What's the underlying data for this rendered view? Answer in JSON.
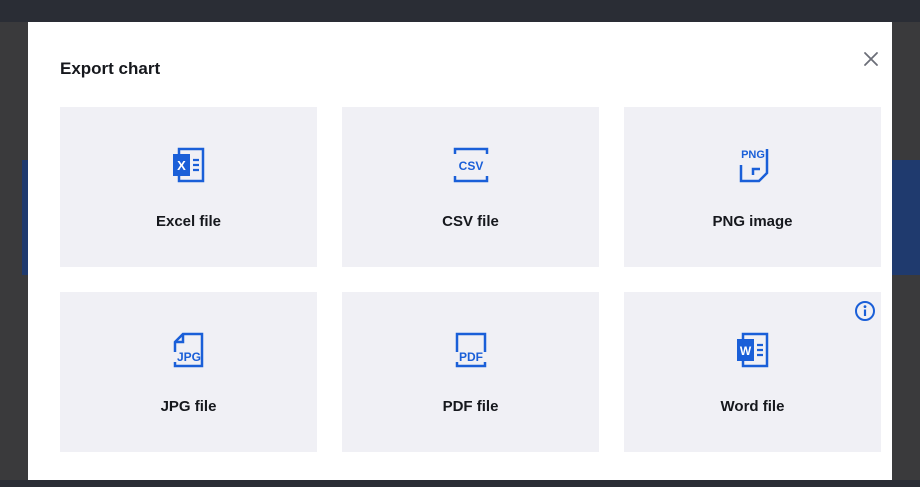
{
  "modal": {
    "title": "Export chart",
    "close_icon": "close-icon",
    "accent_color": "#1a5fd8",
    "card_background": "#f0f0f5",
    "options": [
      {
        "label": "Excel file",
        "icon": "excel-file-icon"
      },
      {
        "label": "CSV file",
        "icon": "csv-file-icon",
        "icon_text": "CSV"
      },
      {
        "label": "PNG image",
        "icon": "png-file-icon",
        "icon_text": "PNG"
      },
      {
        "label": "JPG file",
        "icon": "jpg-file-icon",
        "icon_text": "JPG"
      },
      {
        "label": "PDF file",
        "icon": "pdf-file-icon",
        "icon_text": "PDF"
      },
      {
        "label": "Word file",
        "icon": "word-file-icon",
        "info_icon": "info-icon"
      }
    ]
  }
}
